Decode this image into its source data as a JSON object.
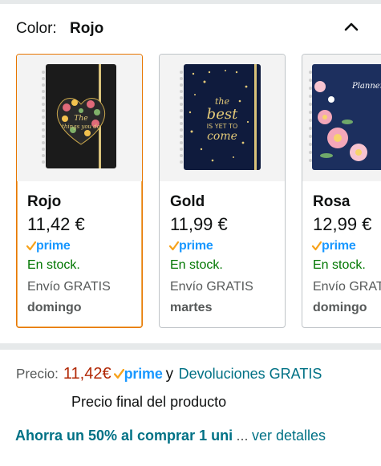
{
  "color_selector": {
    "label": "Color:",
    "selected": "Rojo",
    "collapse_icon": "chevron-up-icon"
  },
  "swatches": [
    {
      "name": "Rojo",
      "price": "11,42 €",
      "prime": "prime",
      "stock": "En stock.",
      "shipping": "Envío GRATIS",
      "delivery_day": "domingo",
      "selected": true,
      "cover_color": "#1a1a1a"
    },
    {
      "name": "Gold",
      "price": "11,99 €",
      "prime": "prime",
      "stock": "En stock.",
      "shipping": "Envío GRATIS",
      "delivery_day": "martes",
      "selected": false,
      "cover_color": "#0f1b3d"
    },
    {
      "name": "Rosa",
      "price": "12,99 €",
      "prime": "prime",
      "stock": "En stock.",
      "shipping": "Envío GRATIS",
      "delivery_day": "domingo",
      "selected": false,
      "cover_color": "#1c2f5e"
    }
  ],
  "price_section": {
    "label": "Precio:",
    "price": "11,42€",
    "prime": "prime",
    "conjunction": "y",
    "returns": "Devoluciones GRATIS",
    "final_note": "Precio final del producto"
  },
  "savings": {
    "text": "Ahorra un 50% al comprar 1 uni",
    "ellipsis": "...",
    "link": "ver detalles"
  },
  "colors": {
    "prime_blue": "#1a98ff",
    "prime_check": "#f7a21a",
    "in_stock_green": "#007600",
    "price_red": "#b12704",
    "link_teal": "#007185",
    "selected_border": "#e77600"
  }
}
